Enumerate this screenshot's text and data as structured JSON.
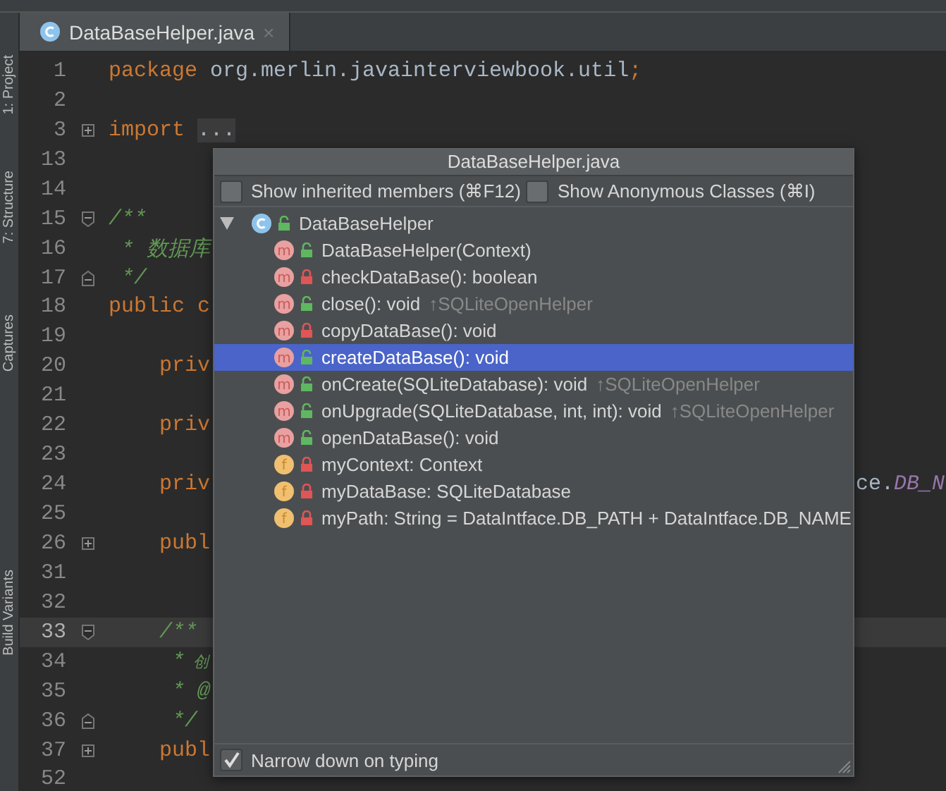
{
  "tool_windows": [
    {
      "label": "1: Project"
    },
    {
      "label": "7: Structure"
    },
    {
      "label": "Captures"
    },
    {
      "label": "Build Variants"
    }
  ],
  "editor_tab": {
    "title": "DataBaseHelper.java",
    "close": "×",
    "selected": true
  },
  "code_lines": [
    {
      "number": "1",
      "kind": "plain",
      "tokens": [
        {
          "kind": "keyword",
          "text": "package"
        },
        {
          "kind": "plain",
          "text": " org.merlin.javainterviewbook.util"
        },
        {
          "kind": "keyword",
          "text": ";"
        }
      ]
    },
    {
      "number": "2",
      "kind": "plain"
    },
    {
      "number": "3",
      "kind": "folded",
      "tokens": [
        {
          "kind": "keyword",
          "text": "import"
        },
        {
          "kind": "folded",
          "text": "..."
        }
      ]
    },
    {
      "number": "13",
      "kind": "plain"
    },
    {
      "number": "14",
      "kind": "plain"
    },
    {
      "number": "15",
      "kind": "block-start",
      "tokens": [
        {
          "kind": "comment",
          "text": "/**"
        }
      ]
    },
    {
      "number": "16",
      "kind": "plain",
      "tokens": [
        {
          "kind": "comment",
          "text": " * 数据库"
        }
      ]
    },
    {
      "number": "17",
      "kind": "block-end",
      "tokens": [
        {
          "kind": "comment",
          "text": " */"
        }
      ]
    },
    {
      "number": "18",
      "kind": "plain",
      "tokens": [
        {
          "kind": "keyword",
          "text": "public c"
        }
      ]
    },
    {
      "number": "19",
      "kind": "plain"
    },
    {
      "number": "20",
      "kind": "plain",
      "tokens": [
        {
          "kind": "keyword",
          "text": "    priv"
        }
      ]
    },
    {
      "number": "21",
      "kind": "plain"
    },
    {
      "number": "22",
      "kind": "plain",
      "tokens": [
        {
          "kind": "keyword",
          "text": "    priv"
        }
      ]
    },
    {
      "number": "23",
      "kind": "plain"
    },
    {
      "number": "24",
      "kind": "plain",
      "tokens": [
        {
          "kind": "keyword",
          "text": "    priv"
        }
      ],
      "tail": [
        {
          "kind": "plain",
          "text": "ce."
        },
        {
          "kind": "constant",
          "text": "DB_N"
        }
      ]
    },
    {
      "number": "25",
      "kind": "plain"
    },
    {
      "number": "26",
      "kind": "folded",
      "tokens": [
        {
          "kind": "keyword",
          "text": "    publ"
        }
      ]
    },
    {
      "number": "31",
      "kind": "plain"
    },
    {
      "number": "32",
      "kind": "plain"
    },
    {
      "number": "33",
      "kind": "block-start",
      "current": true,
      "tokens": [
        {
          "kind": "comment",
          "text": "    /**"
        }
      ]
    },
    {
      "number": "34",
      "kind": "plain",
      "tokens": [
        {
          "kind": "comment",
          "text": "     * "
        },
        {
          "kind": "comment-cjk",
          "text": "创"
        }
      ]
    },
    {
      "number": "35",
      "kind": "plain",
      "tokens": [
        {
          "kind": "comment",
          "text": "     * @"
        }
      ]
    },
    {
      "number": "36",
      "kind": "block-end",
      "tokens": [
        {
          "kind": "comment",
          "text": "     */"
        }
      ]
    },
    {
      "number": "37",
      "kind": "folded",
      "tokens": [
        {
          "kind": "keyword",
          "text": "    publ"
        }
      ]
    },
    {
      "number": "52",
      "kind": "plain"
    }
  ],
  "structure_popup": {
    "title": "DataBaseHelper.java",
    "options": [
      {
        "label": "Show inherited members (⌘F12)",
        "checked": false
      },
      {
        "label": "Show Anonymous Classes (⌘I)",
        "checked": false
      }
    ],
    "tree": {
      "name": "DataBaseHelper",
      "expanded": true,
      "kind": "class",
      "locked": false,
      "children": [
        {
          "kind": "method",
          "badge": "m",
          "locked": false,
          "text": "DataBaseHelper(Context)",
          "selected": false
        },
        {
          "kind": "method",
          "badge": "m",
          "locked": true,
          "text": "checkDataBase(): boolean",
          "selected": false
        },
        {
          "kind": "method",
          "badge": "m",
          "locked": false,
          "text": "close(): void",
          "inherited": "↑SQLiteOpenHelper",
          "selected": false
        },
        {
          "kind": "method",
          "badge": "m",
          "locked": true,
          "text": "copyDataBase(): void",
          "selected": false
        },
        {
          "kind": "method",
          "badge": "m",
          "locked": false,
          "text": "createDataBase(): void",
          "selected": true
        },
        {
          "kind": "method",
          "badge": "m",
          "locked": false,
          "text": "onCreate(SQLiteDatabase): void",
          "inherited": "↑SQLiteOpenHelper",
          "selected": false
        },
        {
          "kind": "method",
          "badge": "m",
          "locked": false,
          "text": "onUpgrade(SQLiteDatabase, int, int): void",
          "inherited": "↑SQLiteOpenHelper",
          "selected": false
        },
        {
          "kind": "method",
          "badge": "m",
          "locked": false,
          "text": "openDataBase(): void",
          "selected": false
        },
        {
          "kind": "field",
          "badge": "f",
          "locked": true,
          "text": "myContext: Context",
          "selected": false
        },
        {
          "kind": "field",
          "badge": "f",
          "locked": true,
          "text": "myDataBase: SQLiteDatabase",
          "selected": false
        },
        {
          "kind": "field",
          "badge": "f",
          "locked": true,
          "text": "myPath: String = DataIntface.DB_PATH + DataIntface.DB_NAME",
          "selected": false
        }
      ]
    },
    "narrow_down": {
      "label": "Narrow down on typing",
      "checked": true
    }
  }
}
